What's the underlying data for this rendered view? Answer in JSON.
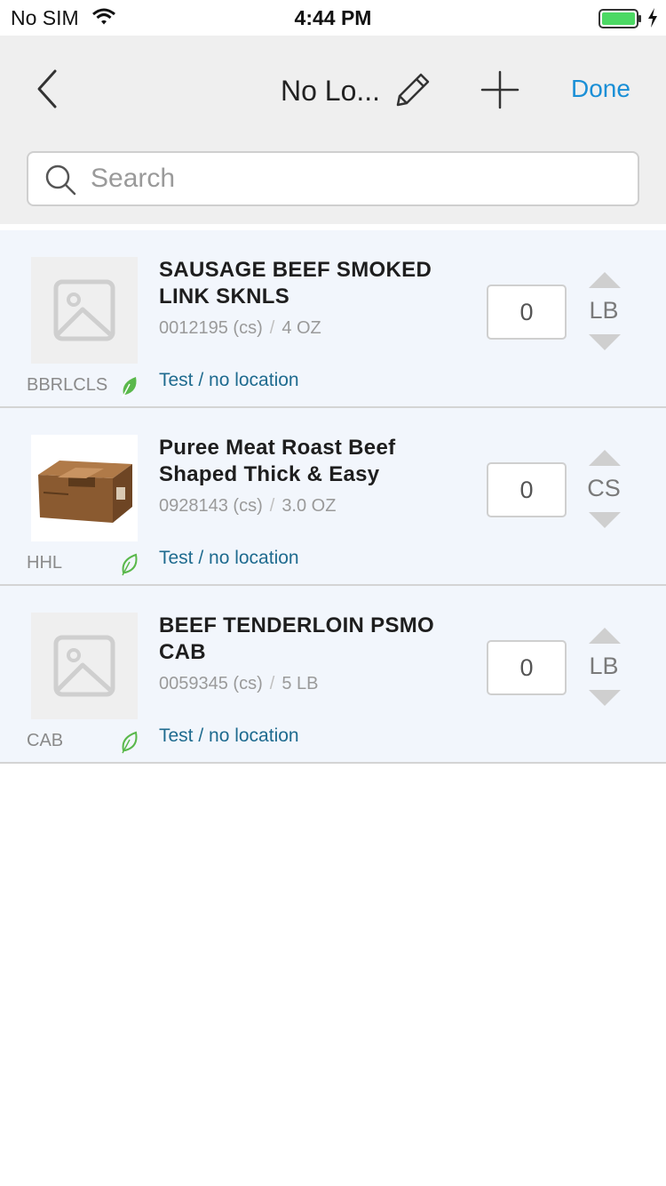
{
  "status_bar": {
    "carrier": "No SIM",
    "time": "4:44 PM",
    "battery_color": "#4cd964"
  },
  "nav": {
    "title": "No Lo...",
    "done_label": "Done",
    "accent_color": "#1a8fd6",
    "icons": [
      "chevron-left-icon",
      "pencil-icon",
      "plus-icon"
    ]
  },
  "search": {
    "placeholder": "Search",
    "value": ""
  },
  "items": [
    {
      "name": "SAUSAGE BEEF SMOKED LINK SKNLS",
      "code": "0012195 (cs)",
      "pack": "4 OZ",
      "brand": "BBRLCLS",
      "location": "Test / no location",
      "quantity": "0",
      "unit": "LB",
      "image": "placeholder-image-icon",
      "leaf": "filled"
    },
    {
      "name": "Puree Meat Roast Beef Shaped Thick & Easy",
      "code": "0928143 (cs)",
      "pack": "3.0 OZ",
      "brand": "HHL",
      "location": "Test / no location",
      "quantity": "0",
      "unit": "CS",
      "image": "product-box-photo",
      "leaf": "outline"
    },
    {
      "name": "BEEF TENDERLOIN PSMO CAB",
      "code": "0059345 (cs)",
      "pack": "5 LB",
      "brand": "CAB",
      "location": "Test / no location",
      "quantity": "0",
      "unit": "LB",
      "image": "placeholder-image-icon",
      "leaf": "outline"
    }
  ]
}
